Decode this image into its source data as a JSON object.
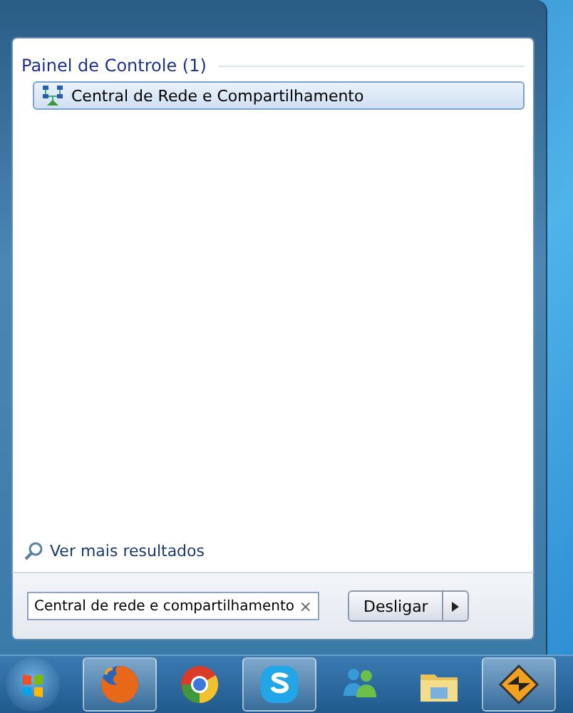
{
  "results": {
    "groups": [
      {
        "title": "Painel de Controle (1)",
        "items": [
          {
            "label": "Central de Rede e Compartilhamento",
            "selected": true
          }
        ]
      }
    ],
    "more_results": "Ver mais resultados"
  },
  "search": {
    "value": "Central de rede e compartilhamento",
    "clear": "×"
  },
  "shutdown": {
    "label": "Desligar"
  },
  "taskbar": {
    "apps": [
      {
        "kind": "firefox",
        "running": true
      },
      {
        "kind": "chrome",
        "running": false
      },
      {
        "kind": "skype",
        "running": true
      },
      {
        "kind": "messenger",
        "running": false
      },
      {
        "kind": "explorer",
        "running": false
      },
      {
        "kind": "winamp",
        "running": true
      }
    ]
  }
}
